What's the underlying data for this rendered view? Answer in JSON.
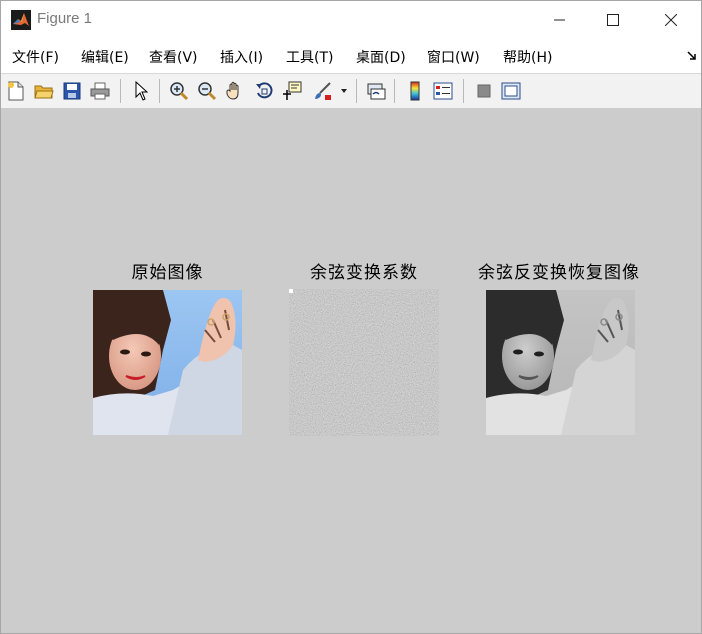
{
  "window": {
    "title": "Figure 1"
  },
  "menu": [
    "文件(F)",
    "编辑(E)",
    "查看(V)",
    "插入(I)",
    "工具(T)",
    "桌面(D)",
    "窗口(W)",
    "帮助(H)"
  ],
  "toolbar": {
    "buttons": [
      "new-figure",
      "open-file",
      "save-figure",
      "print-figure",
      "edit-plot",
      "zoom-in",
      "zoom-out",
      "pan",
      "rotate-3d",
      "data-cursor",
      "brush",
      "brush-dropdown",
      "link-plot",
      "insert-colorbar",
      "insert-legend",
      "hide-plot-tools",
      "show-plot-tools"
    ]
  },
  "axes": [
    {
      "title": "原始图像",
      "image": "color photograph of a smiling woman with raised hand"
    },
    {
      "title": "余弦变换系数",
      "image": "gray noise texture of DCT coefficients"
    },
    {
      "title": "余弦反变换恢复图像",
      "image": "grayscale reconstruction of the photograph"
    }
  ],
  "colors": {
    "figure_bg": "#cccccc",
    "toolbar_bg": "#f2f2f2",
    "title_text": "#7a7a7a",
    "matlab_orange": "#e16737"
  }
}
